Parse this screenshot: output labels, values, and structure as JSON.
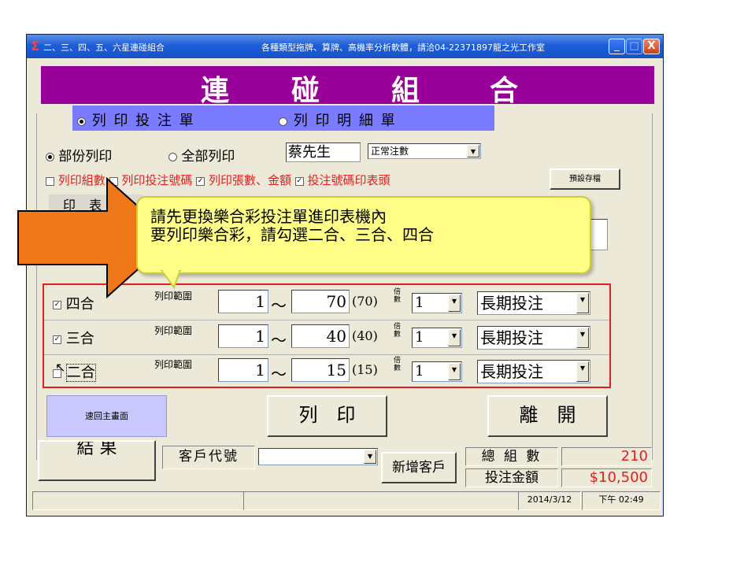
{
  "window": {
    "title_left": "二、三、四、五、六星連碰組合",
    "title_right": "各種類型拖牌、算牌、高機率分析軟體，請洽04-22371897龍之光工作室",
    "min": "_",
    "max": "□",
    "close": "X"
  },
  "banner": {
    "c1": "連",
    "c2": "碰",
    "c3": "組",
    "c4": "合"
  },
  "tabs": {
    "print_ticket": "列 印 投 注 單",
    "print_detail": "列 印 明 細 單"
  },
  "print_mode": {
    "partial": "部份列印",
    "all": "全部列印",
    "customer_name": "蔡先生",
    "note_type": "正常注數"
  },
  "options": {
    "print_groups": "列印組數",
    "print_numbers": "列印投注號碼",
    "print_sheets_amount": "列印張數、金額",
    "header_numbers": "投注號碼印表頭",
    "save_default": "預設存檔"
  },
  "printer_label": "印 表 機",
  "rows": [
    {
      "label": "四合",
      "range_label": "列印範圍",
      "from": "1",
      "to": "70",
      "total": "(70)",
      "multiplier_label": "倍數",
      "multiplier": "1",
      "mode": "長期投注",
      "checked": true
    },
    {
      "label": "三合",
      "range_label": "列印範圍",
      "from": "1",
      "to": "40",
      "total": "(40)",
      "multiplier_label": "倍數",
      "multiplier": "1",
      "mode": "長期投注",
      "checked": true
    },
    {
      "label": "二合",
      "range_label": "列印範圍",
      "from": "1",
      "to": "15",
      "total": "(15)",
      "multiplier_label": "倍數",
      "multiplier": "1",
      "mode": "長期投注",
      "checked": false
    }
  ],
  "tilde": "～",
  "buttons": {
    "back_main": "速回主畫面",
    "print": "列　印",
    "leave": "離　開",
    "result": "結 果",
    "add_customer": "新增客戶"
  },
  "customer": {
    "label": "客戶代號",
    "value": ""
  },
  "totals": {
    "groups_label": "總 組 數",
    "groups_value": "210",
    "amount_label": "投注金額",
    "amount_value": "$10,500"
  },
  "status": {
    "date": "2014/3/12",
    "time": "下午 02:49"
  },
  "callout": {
    "line1": "請先更換樂合彩投注單進印表機內",
    "line2": "要列印樂合彩，請勾選二合、三合、四合"
  },
  "colors": {
    "banner": "#990099",
    "tabs": "#7b7bff",
    "highlight_box": "#e02020",
    "arrow": "#f07818",
    "callout": "#ffff88",
    "money": "#e02020"
  }
}
